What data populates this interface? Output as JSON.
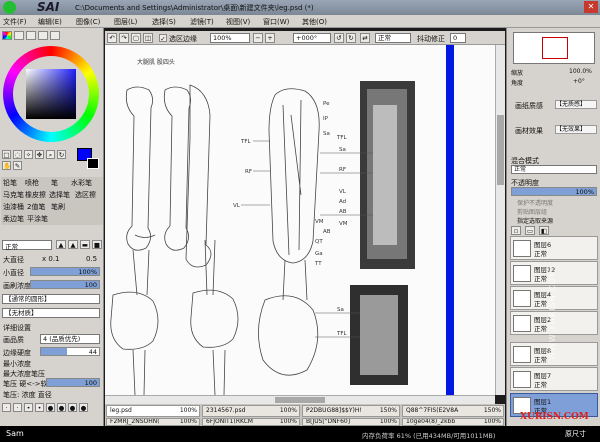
{
  "app": {
    "logo_text": "SAI",
    "title": "C:\\Documents and Settings\\Administrator\\桌面\\新建文件夹\\leg.psd (*)"
  },
  "window_controls": {
    "close": "✕"
  },
  "menu": [
    "文件(F)",
    "编辑(E)",
    "图像(C)",
    "图层(L)",
    "选择(S)",
    "滤镜(T)",
    "视图(V)",
    "窗口(W)",
    "其他(O)"
  ],
  "toolbar": {
    "selection_edge_label": "选区边缘",
    "zoom_value": "100%",
    "rotation_value": "+000°",
    "mode_label": "正常",
    "stabilizer_label": "抖动修正",
    "stabilizer_value": "0"
  },
  "tools": [
    "铅笔",
    "喷枪",
    "笔",
    "水彩笔",
    "马克笔",
    "橡皮擦",
    "选择笔",
    "选区擦",
    "油漆桶",
    "2值笔",
    "笔刷",
    "柔边笔",
    "平涂笔"
  ],
  "brush": {
    "mode": "正常",
    "size_label": "大直径",
    "size_mult": "x 0.1",
    "size_value": "0.5",
    "min_size_label": "小直径",
    "min_size_value": "100%",
    "density_label": "画刷浓度",
    "density_value": "100",
    "shape_label": "【通常的圆形】",
    "texture_label": "【无材质】",
    "detail_label": "详细设置",
    "quality_label": "画品质",
    "quality_value": "4 (品质优先)",
    "edge_label": "边缘硬度",
    "edge_value": "44",
    "min_density_label": "最小浓度",
    "pressure_label": "最大浓度笔压",
    "pressure_hard_label": "笔压 硬<->软",
    "pressure_hard_value": "100",
    "pressure_flags": "笔压:  浓度   直径"
  },
  "navigator": {
    "zoom_label": "缩放",
    "zoom_value": "100.0%",
    "angle_label": "角度",
    "angle_value": "+0°"
  },
  "layer_props": {
    "paper_texture_label": "画纸质感",
    "paper_texture_value": "【无质感】",
    "effect_label": "画材效果",
    "effect_value": "【无效果】",
    "blend_label": "混合模式",
    "blend_value": "正常",
    "opacity_label": "不透明度",
    "opacity_value": "100%",
    "protect_opacity": "保护不透明度",
    "clip_group": "剪贴图层组",
    "selection_source": "指定选取来源"
  },
  "layers": [
    {
      "name": "图层6",
      "mode": "正常",
      "opacity": "100%"
    },
    {
      "name": "图层12",
      "mode": "正常",
      "opacity": "100%"
    },
    {
      "name": "图层4",
      "mode": "正常",
      "opacity": "100%"
    },
    {
      "name": "图层2",
      "mode": "正常",
      "opacity": "100%"
    },
    {
      "name": "图层8",
      "mode": "正常",
      "opacity": "100%"
    },
    {
      "name": "图层7",
      "mode": "正常",
      "opacity": "100%"
    },
    {
      "name": "图层1",
      "mode": "正常",
      "opacity": "100%"
    }
  ],
  "file_tabs": [
    {
      "name": "leg.psd",
      "zoom": "100%"
    },
    {
      "name": "2314567.psd",
      "zoom": "100%"
    },
    {
      "name": "P2DBUG88]$$Y)H!",
      "zoom": "150%"
    },
    {
      "name": "Q88^7FIS(E2V8A",
      "zoom": "150%"
    },
    {
      "name": "F2MRJ_2NSOHN(",
      "zoom": "100%"
    },
    {
      "name": "6FJONIT1(RKCM",
      "zoom": "100%"
    },
    {
      "name": "B[JUS[\"DNF60]",
      "zoom": "100%"
    },
    {
      "name": "10ge04(8)_2kbb",
      "zoom": "100%"
    }
  ],
  "status": {
    "user": "Sam",
    "memory": "内存负荷率 61% (已用434MB/可用1011MB)",
    "original_size": "原尺寸"
  },
  "canvas_text": {
    "heading": "大腿肌  股四头",
    "labels_mid": [
      "TFL",
      "RF",
      "VL",
      "Pe",
      "IP",
      "Sa",
      "VM",
      "AB",
      "QT",
      "Ga",
      "TT"
    ],
    "labels_right": [
      "TFL",
      "Sa",
      "RF",
      "VL",
      "Ad",
      "AB",
      "VM",
      "Sa",
      "TFL"
    ]
  },
  "watermarks": {
    "brand": "XURISN.COM",
    "side": "WWW.XURISN.COM"
  },
  "colors": {
    "accent": "#0000ff",
    "rule_blue": "#0018e0",
    "watermark_red": "#e0201a"
  }
}
